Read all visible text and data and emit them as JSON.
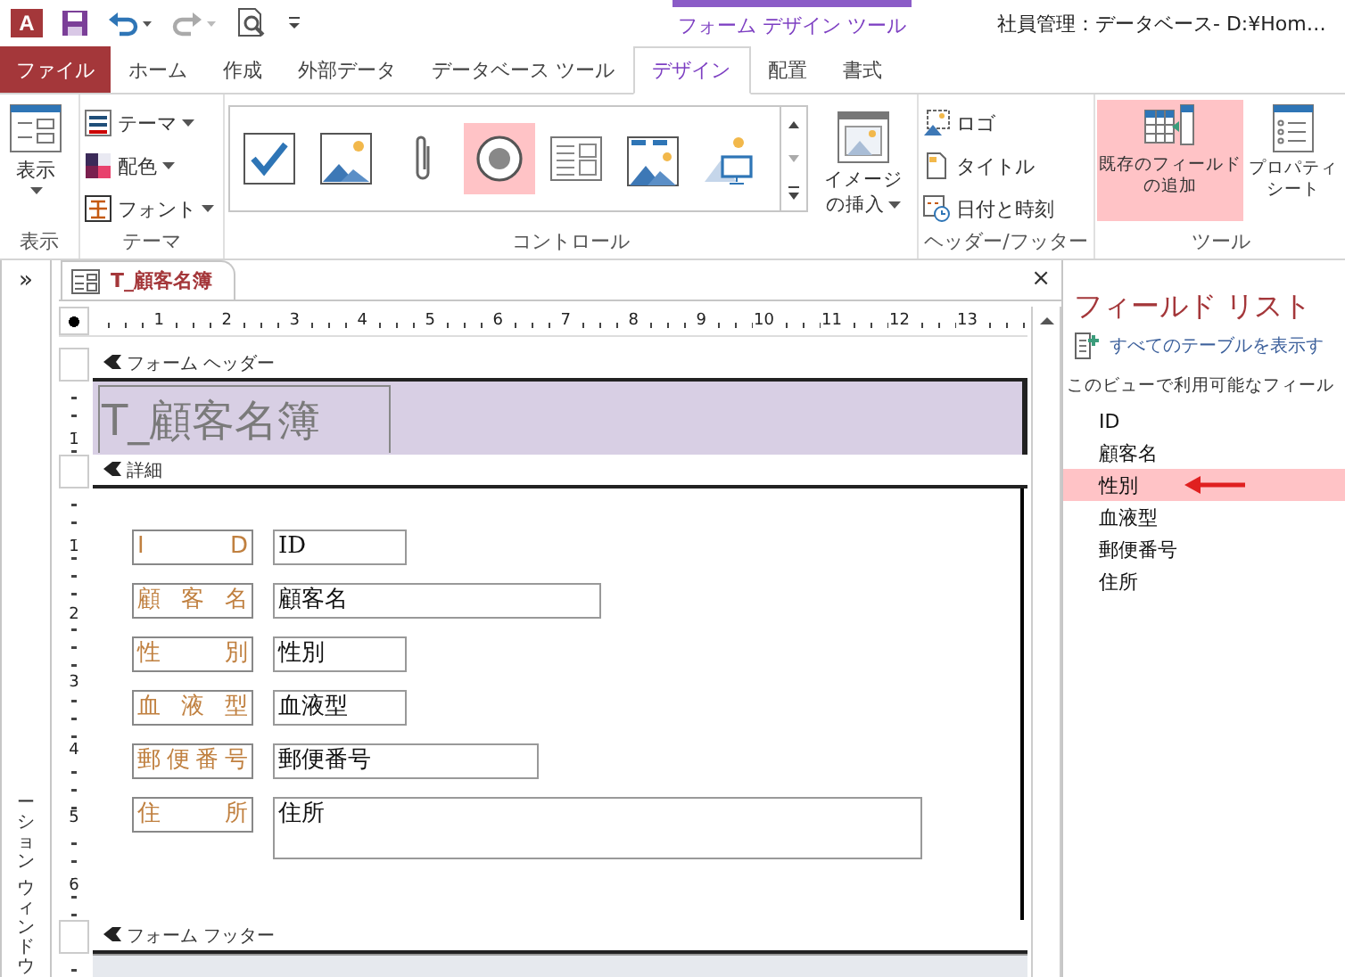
{
  "title_bar": {
    "app_logo": "A",
    "context_tab": "フォーム デザイン ツール",
    "title": "社員管理：データベース- D:¥Hom…"
  },
  "tabs": [
    {
      "label": "ファイル",
      "kind": "file",
      "selected": false
    },
    {
      "label": "ホーム",
      "kind": "tab",
      "selected": false
    },
    {
      "label": "作成",
      "kind": "tab",
      "selected": false
    },
    {
      "label": "外部データ",
      "kind": "tab",
      "selected": false
    },
    {
      "label": "データベース ツール",
      "kind": "tab",
      "selected": false
    },
    {
      "label": "デザイン",
      "kind": "tab",
      "selected": true
    },
    {
      "label": "配置",
      "kind": "tab",
      "selected": false
    },
    {
      "label": "書式",
      "kind": "tab",
      "selected": false
    }
  ],
  "ribbon": {
    "view_group": {
      "label": "表示",
      "button": "表示"
    },
    "theme_group": {
      "label": "テーマ",
      "items": [
        "テーマ",
        "配色",
        "フォント"
      ]
    },
    "controls_group": {
      "label": "コントロール",
      "gallery": [
        {
          "kind": "checkbox",
          "selected": false
        },
        {
          "kind": "image",
          "selected": false
        },
        {
          "kind": "attachment",
          "selected": false
        },
        {
          "kind": "option",
          "selected": true
        },
        {
          "kind": "subform",
          "selected": false
        },
        {
          "kind": "chart",
          "selected": false
        },
        {
          "kind": "frame",
          "selected": false
        }
      ],
      "insert_image": [
        "イメージ",
        "の挿入"
      ]
    },
    "header_footer_group": {
      "label": "ヘッダー/フッター",
      "items": [
        "ロゴ",
        "タイトル",
        "日付と時刻"
      ]
    },
    "tools_group": {
      "label": "ツール",
      "items": [
        {
          "lines": [
            "既存のフィールド",
            "の追加"
          ],
          "highlighted": true
        },
        {
          "lines": [
            "プロパティ",
            "シート"
          ],
          "highlighted": false
        }
      ]
    }
  },
  "nav_pane": {
    "toggle": "»",
    "label": [
      "ーション",
      "ウィンドウ"
    ]
  },
  "document": {
    "tab": "T_顧客名簿",
    "close": "×",
    "ruler": [
      "1",
      "2",
      "3",
      "4",
      "5",
      "6",
      "7",
      "8",
      "9",
      "10",
      "11",
      "12",
      "13"
    ],
    "header": {
      "label": "フォーム ヘッダー",
      "ruler": [
        "1"
      ],
      "title": "T_顧客名簿"
    },
    "detail": {
      "label": "詳細",
      "ruler": [
        "1",
        "2",
        "3",
        "4",
        "5",
        "6"
      ],
      "controls": [
        {
          "label": "I D",
          "value": "ID",
          "kind": "short"
        },
        {
          "label": "顧 客 名",
          "value": "顧客名",
          "kind": "long"
        },
        {
          "label": "性 別",
          "value": "性別",
          "kind": "short"
        },
        {
          "label": "血 液 型",
          "value": "血液型",
          "kind": "short"
        },
        {
          "label": "郵便番号",
          "value": "郵便番号",
          "kind": "medium"
        },
        {
          "label": "住 所",
          "value": "住所",
          "kind": "multi"
        }
      ]
    },
    "footer": {
      "label": "フォーム フッター"
    }
  },
  "field_list": {
    "title": "フィールド リスト",
    "show_all": "すべてのテーブルを表示す",
    "available": "このビューで利用可能なフィール",
    "fields": [
      {
        "name": "ID",
        "highlighted": false
      },
      {
        "name": "顧客名",
        "highlighted": false
      },
      {
        "name": "性別",
        "highlighted": true
      },
      {
        "name": "血液型",
        "highlighted": false
      },
      {
        "name": "郵便番号",
        "highlighted": false
      },
      {
        "name": "住所",
        "highlighted": false
      }
    ]
  }
}
